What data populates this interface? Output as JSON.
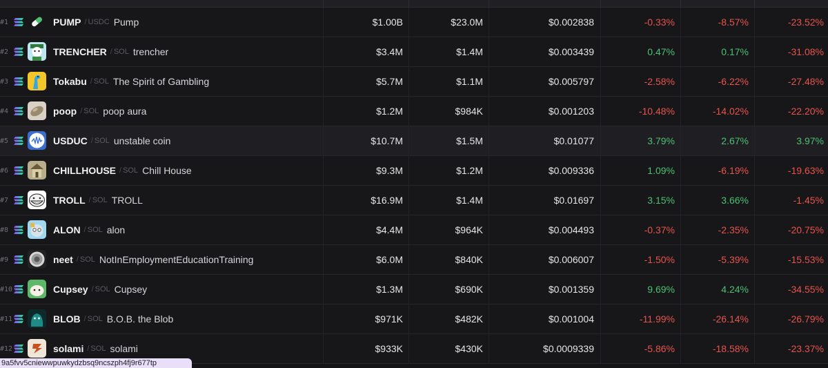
{
  "colors": {
    "positive": "#4cc071",
    "negative": "#e8534b",
    "background": "#17171a"
  },
  "rows": [
    {
      "rank": "#1",
      "chain_icon": "solana-icon",
      "avatar_icon": "pill-icon",
      "symbol": "PUMP",
      "pair": "USDC",
      "name": "Pump",
      "market_cap": "$1.00B",
      "volume": "$23.0M",
      "price": "$0.002838",
      "p1": "-0.33%",
      "p2": "-8.57%",
      "p3": "-23.52%"
    },
    {
      "rank": "#2",
      "chain_icon": "solana-icon",
      "avatar_icon": "trencher-avatar-icon",
      "symbol": "TRENCHER",
      "pair": "SOL",
      "name": "trencher",
      "market_cap": "$3.4M",
      "volume": "$1.4M",
      "price": "$0.003439",
      "p1": "0.47%",
      "p2": "0.17%",
      "p3": "-31.08%"
    },
    {
      "rank": "#3",
      "chain_icon": "solana-icon",
      "avatar_icon": "tokabu-avatar-icon",
      "symbol": "Tokabu",
      "pair": "SOL",
      "name": "The Spirit of Gambling",
      "market_cap": "$5.7M",
      "volume": "$1.1M",
      "price": "$0.005797",
      "p1": "-2.58%",
      "p2": "-6.22%",
      "p3": "-27.48%"
    },
    {
      "rank": "#4",
      "chain_icon": "solana-icon",
      "avatar_icon": "poop-avatar-icon",
      "symbol": "poop",
      "pair": "SOL",
      "name": "poop aura",
      "market_cap": "$1.2M",
      "volume": "$984K",
      "price": "$0.001203",
      "p1": "-10.48%",
      "p2": "-14.02%",
      "p3": "-22.20%"
    },
    {
      "rank": "#5",
      "chain_icon": "solana-icon",
      "avatar_icon": "usduc-avatar-icon",
      "symbol": "USDUC",
      "pair": "SOL",
      "name": "unstable coin",
      "market_cap": "$10.7M",
      "volume": "$1.5M",
      "price": "$0.01077",
      "p1": "3.79%",
      "p2": "2.67%",
      "p3": "3.97%"
    },
    {
      "rank": "#6",
      "chain_icon": "solana-icon",
      "avatar_icon": "chillhouse-avatar-icon",
      "symbol": "CHILLHOUSE",
      "pair": "SOL",
      "name": "Chill House",
      "market_cap": "$9.3M",
      "volume": "$1.2M",
      "price": "$0.009336",
      "p1": "1.09%",
      "p2": "-6.19%",
      "p3": "-19.63%"
    },
    {
      "rank": "#7",
      "chain_icon": "solana-icon",
      "avatar_icon": "troll-avatar-icon",
      "symbol": "TROLL",
      "pair": "SOL",
      "name": "TROLL",
      "market_cap": "$16.9M",
      "volume": "$1.4M",
      "price": "$0.01697",
      "p1": "3.15%",
      "p2": "3.66%",
      "p3": "-1.45%"
    },
    {
      "rank": "#8",
      "chain_icon": "solana-icon",
      "avatar_icon": "alon-avatar-icon",
      "symbol": "ALON",
      "pair": "SOL",
      "name": "alon",
      "market_cap": "$4.4M",
      "volume": "$964K",
      "price": "$0.004493",
      "p1": "-0.37%",
      "p2": "-2.35%",
      "p3": "-20.75%"
    },
    {
      "rank": "#9",
      "chain_icon": "solana-icon",
      "avatar_icon": "neet-avatar-icon",
      "symbol": "neet",
      "pair": "SOL",
      "name": "NotInEmploymentEducationTraining",
      "market_cap": "$6.0M",
      "volume": "$840K",
      "price": "$0.006007",
      "p1": "-1.50%",
      "p2": "-5.39%",
      "p3": "-15.53%"
    },
    {
      "rank": "#10",
      "chain_icon": "solana-icon",
      "avatar_icon": "cupsey-avatar-icon",
      "symbol": "Cupsey",
      "pair": "SOL",
      "name": "Cupsey",
      "market_cap": "$1.3M",
      "volume": "$690K",
      "price": "$0.001359",
      "p1": "9.69%",
      "p2": "4.24%",
      "p3": "-34.55%"
    },
    {
      "rank": "#11",
      "chain_icon": "solana-icon",
      "avatar_icon": "blob-avatar-icon",
      "symbol": "BLOB",
      "pair": "SOL",
      "name": "B.O.B. the Blob",
      "market_cap": "$971K",
      "volume": "$482K",
      "price": "$0.001004",
      "p1": "-11.99%",
      "p2": "-26.14%",
      "p3": "-26.79%"
    },
    {
      "rank": "#12",
      "chain_icon": "solana-icon",
      "avatar_icon": "solami-avatar-icon",
      "symbol": "solami",
      "pair": "SOL",
      "name": "solami",
      "market_cap": "$933K",
      "volume": "$430K",
      "price": "$0.0009339",
      "p1": "-5.86%",
      "p2": "-18.58%",
      "p3": "-23.37%"
    }
  ],
  "tooltip": {
    "text": "9a5fvv5cniewwpuwkydzbsq9ncszph4fj9r677tp"
  }
}
